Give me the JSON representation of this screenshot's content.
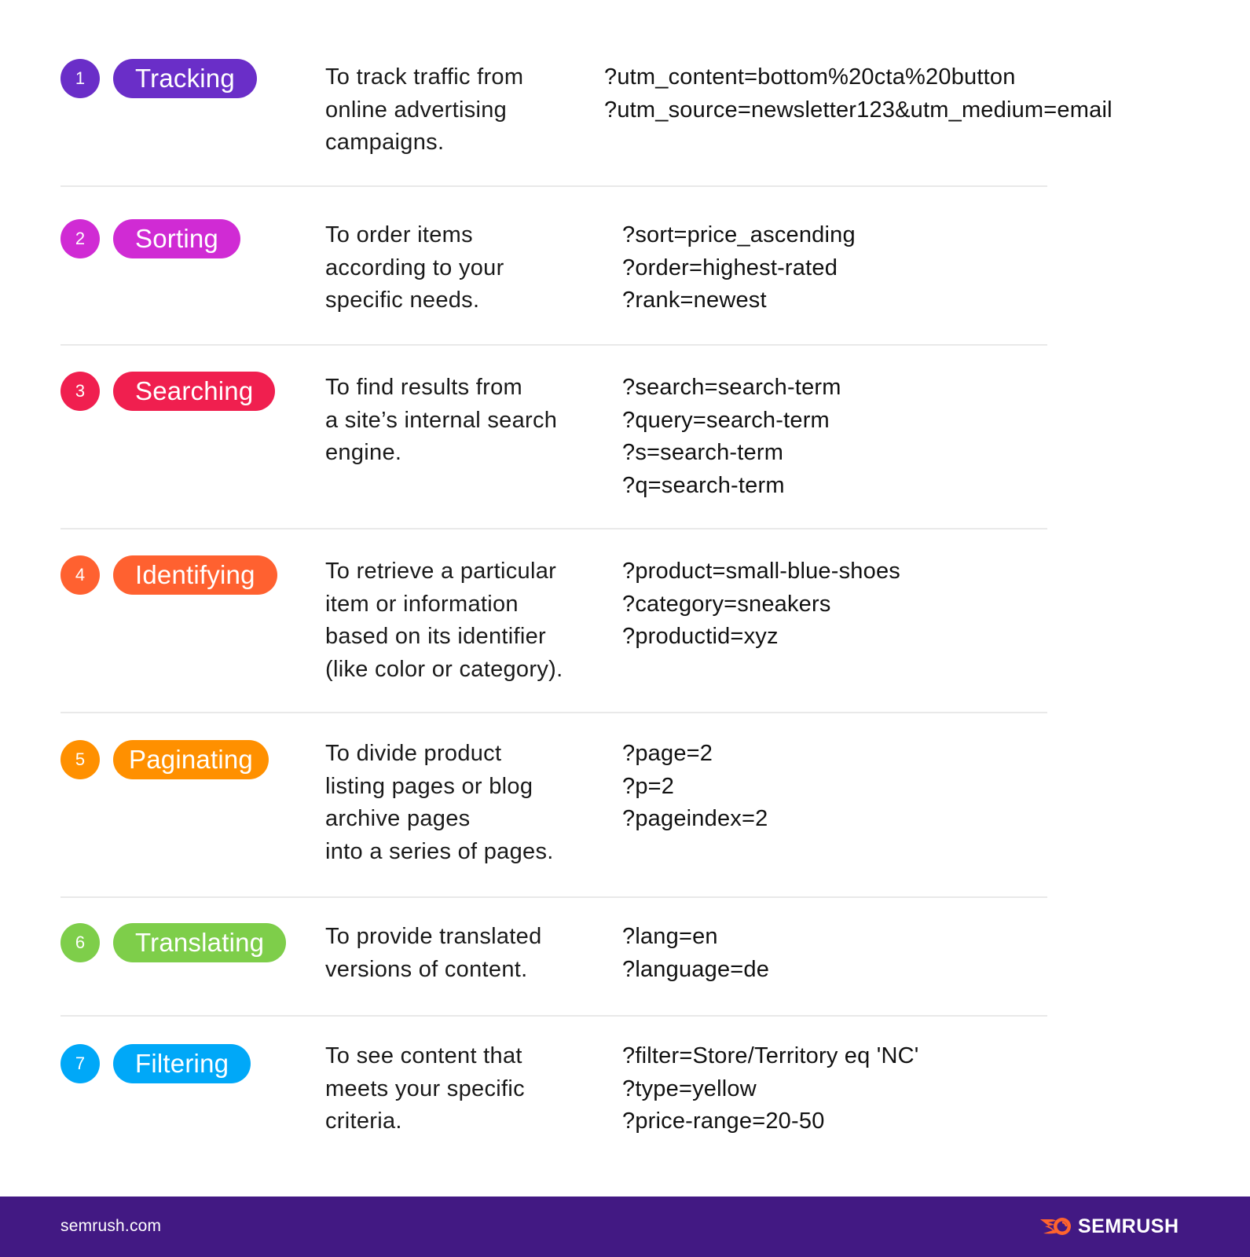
{
  "rows": [
    {
      "number": "1",
      "label": "Tracking",
      "color": "#6a2ec8",
      "description": [
        "To track traffic from",
        "online advertising",
        "campaigns."
      ],
      "examples": [
        "?utm_content=bottom%20cta%20button",
        "?utm_source=newsletter123&utm_medium=email"
      ]
    },
    {
      "number": "2",
      "label": "Sorting",
      "color": "#d02bd4",
      "description": [
        "To order items",
        "according to your",
        "specific needs."
      ],
      "examples": [
        "?sort=price_ascending",
        "?order=highest-rated",
        "?rank=newest"
      ]
    },
    {
      "number": "3",
      "label": "Searching",
      "color": "#f01f4f",
      "description": [
        "To find results from",
        "a site’s internal search",
        "engine."
      ],
      "examples": [
        "?search=search-term",
        "?query=search-term",
        "?s=search-term",
        "?q=search-term"
      ]
    },
    {
      "number": "4",
      "label": "Identifying",
      "color": "#ff6130",
      "description": [
        "To retrieve a particular",
        "item or information",
        "based on its identifier",
        "(like color or category)."
      ],
      "examples": [
        "?product=small-blue-shoes",
        "?category=sneakers",
        "?productid=xyz"
      ]
    },
    {
      "number": "5",
      "label": "Paginating",
      "color": "#ff9000",
      "description": [
        "To divide product",
        "listing pages or blog",
        "archive pages",
        "into a series of pages."
      ],
      "examples": [
        "?page=2",
        "?p=2",
        "?pageindex=2"
      ]
    },
    {
      "number": "6",
      "label": "Translating",
      "color": "#7ece4a",
      "description": [
        "To provide translated",
        "versions of content."
      ],
      "examples": [
        "?lang=en",
        "?language=de"
      ]
    },
    {
      "number": "7",
      "label": "Filtering",
      "color": "#00a8f8",
      "description": [
        "To see content that",
        "meets your specific",
        "criteria."
      ],
      "examples": [
        "?filter=Store/Territory eq 'NC'",
        "?type=yellow",
        "?price-range=20-50"
      ]
    }
  ],
  "footer": {
    "url": "semrush.com",
    "brand": "SEMRUSH",
    "background": "#421983",
    "logo_color": "#ff642d"
  }
}
